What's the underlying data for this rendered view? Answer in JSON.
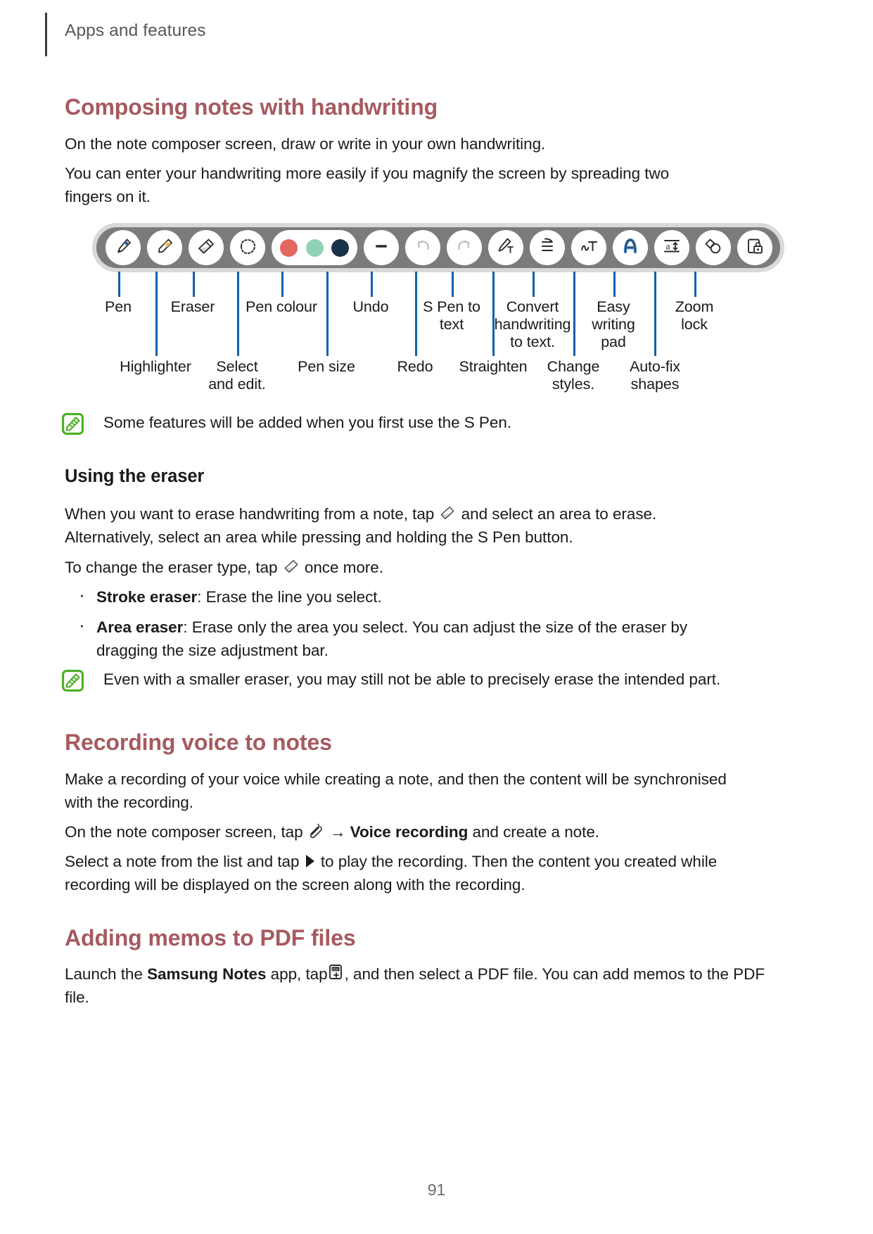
{
  "runninghead": {
    "title": "Apps and features"
  },
  "sections": {
    "composing": {
      "heading": "Composing notes with handwriting",
      "p1": "On the note composer screen, draw or write in your own handwriting.",
      "p2": "You can enter your handwriting more easily if you magnify the screen by spreading two fingers on it.",
      "note": "Some features will be added when you first use the S Pen."
    },
    "eraser": {
      "heading": "Using the eraser",
      "p1_a": "When you want to erase handwriting from a note, tap",
      "p1_b": "and select an area to erase. Alternatively, select an area while pressing and holding the S Pen button.",
      "p2_a": "To change the eraser type, tap",
      "p2_b": "once more.",
      "bullets": [
        {
          "term": "Stroke eraser",
          "rest": ": Erase the line you select."
        },
        {
          "term": "Area eraser",
          "rest": ": Erase only the area you select. You can adjust the size of the eraser by dragging the size adjustment bar."
        }
      ],
      "note": "Even with a smaller eraser, you may still not be able to precisely erase the intended part."
    },
    "recording": {
      "heading": "Recording voice to notes",
      "p1": "Make a recording of your voice while creating a note, and then the content will be synchronised with the recording.",
      "p2_a": "On the note composer screen, tap",
      "p2_arrow": "→",
      "p2_bold": "Voice recording",
      "p2_b": "and create a note.",
      "p3_a": "Select a note from the list and tap",
      "p3_b": "to play the recording. Then the content you created while recording will be displayed on the screen along with the recording."
    },
    "pdf": {
      "heading": "Adding memos to PDF files",
      "p1_a": "Launch the",
      "p1_bold": "Samsung Notes",
      "p1_b": "app, tap",
      "p1_c": ", and then select a PDF file. You can add memos to the PDF file."
    }
  },
  "figure": {
    "name": "s-pen-toolbar-diagram",
    "buttons": [
      {
        "name": "pen-icon",
        "label": "Pen"
      },
      {
        "name": "highlighter-icon",
        "label": "Highlighter"
      },
      {
        "name": "eraser-icon",
        "label": "Eraser"
      },
      {
        "name": "select-and-edit-icon",
        "label": "Select and edit."
      },
      {
        "name": "pen-colour-swatches",
        "label": "Pen colour"
      },
      {
        "name": "pen-size-icon",
        "label": "Pen size"
      },
      {
        "name": "undo-icon",
        "label": "Undo"
      },
      {
        "name": "redo-icon",
        "label": "Redo"
      },
      {
        "name": "s-pen-to-text-icon",
        "label": "S Pen to text"
      },
      {
        "name": "straighten-icon",
        "label": "Straighten"
      },
      {
        "name": "convert-handwriting-to-text-icon",
        "label": "Convert handwriting to text."
      },
      {
        "name": "change-styles-icon",
        "label": "Change styles."
      },
      {
        "name": "easy-writing-pad-icon",
        "label": "Easy writing pad"
      },
      {
        "name": "auto-fix-shapes-icon",
        "label": "Auto-fix shapes"
      },
      {
        "name": "zoom-lock-icon",
        "label": "Zoom lock"
      }
    ],
    "labels_row1": [
      {
        "text": "Pen"
      },
      {
        "text": "Eraser"
      },
      {
        "text": "Pen colour"
      },
      {
        "text": "Undo"
      },
      {
        "text": "S Pen to\ntext"
      },
      {
        "text": "Convert\nhandwriting\nto text."
      },
      {
        "text": "Easy\nwriting\npad"
      },
      {
        "text": "Zoom\nlock"
      }
    ],
    "labels_row2": [
      {
        "text": "Highlighter"
      },
      {
        "text": "Select\nand edit."
      },
      {
        "text": "Pen size"
      },
      {
        "text": "Redo"
      },
      {
        "text": "Straighten"
      },
      {
        "text": "Change\nstyles."
      },
      {
        "text": "Auto-fix\nshapes"
      }
    ],
    "pen_colours": [
      "#e2675f",
      "#8fd2b8",
      "#1b3347"
    ]
  },
  "footer": {
    "page_number": "91"
  },
  "colors": {
    "heading": "#a65a60",
    "leader": "#1061a8",
    "toolbar_bg": "#7b7b7b",
    "note_icon": "#4caf24",
    "runhead_text": "#58585a"
  }
}
